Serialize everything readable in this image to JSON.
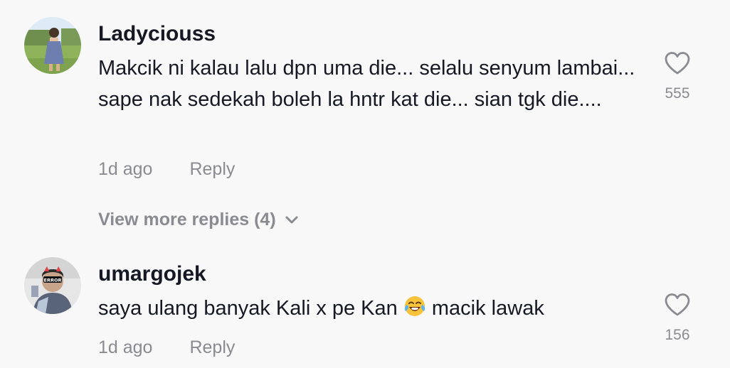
{
  "comments": [
    {
      "username": "Ladyciouss",
      "text": "Makcik ni kalau lalu dpn uma die... selalu senyum lambai... sape nak sedekah boleh la hntr kat die... sian tgk die....",
      "time": "1d ago",
      "reply_label": "Reply",
      "likes": "555",
      "icon": "heart-outline-icon"
    },
    {
      "username": "umargojek",
      "text_before": "saya ulang banyak Kali x pe Kan ",
      "emoji": "face-with-tears-of-joy",
      "text_after": " macik lawak",
      "time": "1d ago",
      "reply_label": "Reply",
      "likes": "156",
      "icon": "heart-outline-icon"
    }
  ],
  "view_more": {
    "label": "View more replies (4)"
  },
  "colors": {
    "primary_text": "#161823",
    "secondary_text": "#8a8b91",
    "background": "#f8f8f8"
  }
}
